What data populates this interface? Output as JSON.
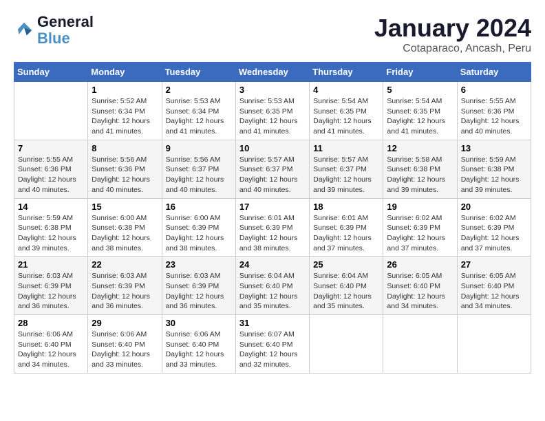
{
  "header": {
    "logo_line1": "General",
    "logo_line2": "Blue",
    "month_title": "January 2024",
    "subtitle": "Cotaparaco, Ancash, Peru"
  },
  "weekdays": [
    "Sunday",
    "Monday",
    "Tuesday",
    "Wednesday",
    "Thursday",
    "Friday",
    "Saturday"
  ],
  "weeks": [
    [
      {
        "day": "",
        "lines": []
      },
      {
        "day": "1",
        "lines": [
          "Sunrise: 5:52 AM",
          "Sunset: 6:34 PM",
          "Daylight: 12 hours",
          "and 41 minutes."
        ]
      },
      {
        "day": "2",
        "lines": [
          "Sunrise: 5:53 AM",
          "Sunset: 6:34 PM",
          "Daylight: 12 hours",
          "and 41 minutes."
        ]
      },
      {
        "day": "3",
        "lines": [
          "Sunrise: 5:53 AM",
          "Sunset: 6:35 PM",
          "Daylight: 12 hours",
          "and 41 minutes."
        ]
      },
      {
        "day": "4",
        "lines": [
          "Sunrise: 5:54 AM",
          "Sunset: 6:35 PM",
          "Daylight: 12 hours",
          "and 41 minutes."
        ]
      },
      {
        "day": "5",
        "lines": [
          "Sunrise: 5:54 AM",
          "Sunset: 6:35 PM",
          "Daylight: 12 hours",
          "and 41 minutes."
        ]
      },
      {
        "day": "6",
        "lines": [
          "Sunrise: 5:55 AM",
          "Sunset: 6:36 PM",
          "Daylight: 12 hours",
          "and 40 minutes."
        ]
      }
    ],
    [
      {
        "day": "7",
        "lines": [
          "Sunrise: 5:55 AM",
          "Sunset: 6:36 PM",
          "Daylight: 12 hours",
          "and 40 minutes."
        ]
      },
      {
        "day": "8",
        "lines": [
          "Sunrise: 5:56 AM",
          "Sunset: 6:36 PM",
          "Daylight: 12 hours",
          "and 40 minutes."
        ]
      },
      {
        "day": "9",
        "lines": [
          "Sunrise: 5:56 AM",
          "Sunset: 6:37 PM",
          "Daylight: 12 hours",
          "and 40 minutes."
        ]
      },
      {
        "day": "10",
        "lines": [
          "Sunrise: 5:57 AM",
          "Sunset: 6:37 PM",
          "Daylight: 12 hours",
          "and 40 minutes."
        ]
      },
      {
        "day": "11",
        "lines": [
          "Sunrise: 5:57 AM",
          "Sunset: 6:37 PM",
          "Daylight: 12 hours",
          "and 39 minutes."
        ]
      },
      {
        "day": "12",
        "lines": [
          "Sunrise: 5:58 AM",
          "Sunset: 6:38 PM",
          "Daylight: 12 hours",
          "and 39 minutes."
        ]
      },
      {
        "day": "13",
        "lines": [
          "Sunrise: 5:59 AM",
          "Sunset: 6:38 PM",
          "Daylight: 12 hours",
          "and 39 minutes."
        ]
      }
    ],
    [
      {
        "day": "14",
        "lines": [
          "Sunrise: 5:59 AM",
          "Sunset: 6:38 PM",
          "Daylight: 12 hours",
          "and 39 minutes."
        ]
      },
      {
        "day": "15",
        "lines": [
          "Sunrise: 6:00 AM",
          "Sunset: 6:38 PM",
          "Daylight: 12 hours",
          "and 38 minutes."
        ]
      },
      {
        "day": "16",
        "lines": [
          "Sunrise: 6:00 AM",
          "Sunset: 6:39 PM",
          "Daylight: 12 hours",
          "and 38 minutes."
        ]
      },
      {
        "day": "17",
        "lines": [
          "Sunrise: 6:01 AM",
          "Sunset: 6:39 PM",
          "Daylight: 12 hours",
          "and 38 minutes."
        ]
      },
      {
        "day": "18",
        "lines": [
          "Sunrise: 6:01 AM",
          "Sunset: 6:39 PM",
          "Daylight: 12 hours",
          "and 37 minutes."
        ]
      },
      {
        "day": "19",
        "lines": [
          "Sunrise: 6:02 AM",
          "Sunset: 6:39 PM",
          "Daylight: 12 hours",
          "and 37 minutes."
        ]
      },
      {
        "day": "20",
        "lines": [
          "Sunrise: 6:02 AM",
          "Sunset: 6:39 PM",
          "Daylight: 12 hours",
          "and 37 minutes."
        ]
      }
    ],
    [
      {
        "day": "21",
        "lines": [
          "Sunrise: 6:03 AM",
          "Sunset: 6:39 PM",
          "Daylight: 12 hours",
          "and 36 minutes."
        ]
      },
      {
        "day": "22",
        "lines": [
          "Sunrise: 6:03 AM",
          "Sunset: 6:39 PM",
          "Daylight: 12 hours",
          "and 36 minutes."
        ]
      },
      {
        "day": "23",
        "lines": [
          "Sunrise: 6:03 AM",
          "Sunset: 6:39 PM",
          "Daylight: 12 hours",
          "and 36 minutes."
        ]
      },
      {
        "day": "24",
        "lines": [
          "Sunrise: 6:04 AM",
          "Sunset: 6:40 PM",
          "Daylight: 12 hours",
          "and 35 minutes."
        ]
      },
      {
        "day": "25",
        "lines": [
          "Sunrise: 6:04 AM",
          "Sunset: 6:40 PM",
          "Daylight: 12 hours",
          "and 35 minutes."
        ]
      },
      {
        "day": "26",
        "lines": [
          "Sunrise: 6:05 AM",
          "Sunset: 6:40 PM",
          "Daylight: 12 hours",
          "and 34 minutes."
        ]
      },
      {
        "day": "27",
        "lines": [
          "Sunrise: 6:05 AM",
          "Sunset: 6:40 PM",
          "Daylight: 12 hours",
          "and 34 minutes."
        ]
      }
    ],
    [
      {
        "day": "28",
        "lines": [
          "Sunrise: 6:06 AM",
          "Sunset: 6:40 PM",
          "Daylight: 12 hours",
          "and 34 minutes."
        ]
      },
      {
        "day": "29",
        "lines": [
          "Sunrise: 6:06 AM",
          "Sunset: 6:40 PM",
          "Daylight: 12 hours",
          "and 33 minutes."
        ]
      },
      {
        "day": "30",
        "lines": [
          "Sunrise: 6:06 AM",
          "Sunset: 6:40 PM",
          "Daylight: 12 hours",
          "and 33 minutes."
        ]
      },
      {
        "day": "31",
        "lines": [
          "Sunrise: 6:07 AM",
          "Sunset: 6:40 PM",
          "Daylight: 12 hours",
          "and 32 minutes."
        ]
      },
      {
        "day": "",
        "lines": []
      },
      {
        "day": "",
        "lines": []
      },
      {
        "day": "",
        "lines": []
      }
    ]
  ]
}
